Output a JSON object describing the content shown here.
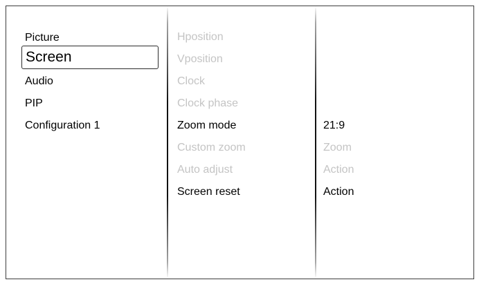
{
  "main_menu": {
    "items": [
      {
        "label": "Picture",
        "selected": false
      },
      {
        "label": "Screen",
        "selected": true
      },
      {
        "label": "Audio",
        "selected": false
      },
      {
        "label": "PIP",
        "selected": false
      },
      {
        "label": "Configuration 1",
        "selected": false
      }
    ]
  },
  "screen_menu": {
    "items": [
      {
        "label": "Hposition",
        "enabled": false,
        "value": ""
      },
      {
        "label": "Vposition",
        "enabled": false,
        "value": ""
      },
      {
        "label": "Clock",
        "enabled": false,
        "value": ""
      },
      {
        "label": "Clock phase",
        "enabled": false,
        "value": ""
      },
      {
        "label": "Zoom mode",
        "enabled": true,
        "value": "21:9"
      },
      {
        "label": "Custom zoom",
        "enabled": false,
        "value": "Zoom"
      },
      {
        "label": "Auto adjust",
        "enabled": false,
        "value": "Action"
      },
      {
        "label": "Screen reset",
        "enabled": true,
        "value": "Action"
      }
    ]
  },
  "colors": {
    "enabled_text": "#000000",
    "disabled_text": "#c4c4c4",
    "background": "#ffffff",
    "border": "#3c3c3c"
  }
}
